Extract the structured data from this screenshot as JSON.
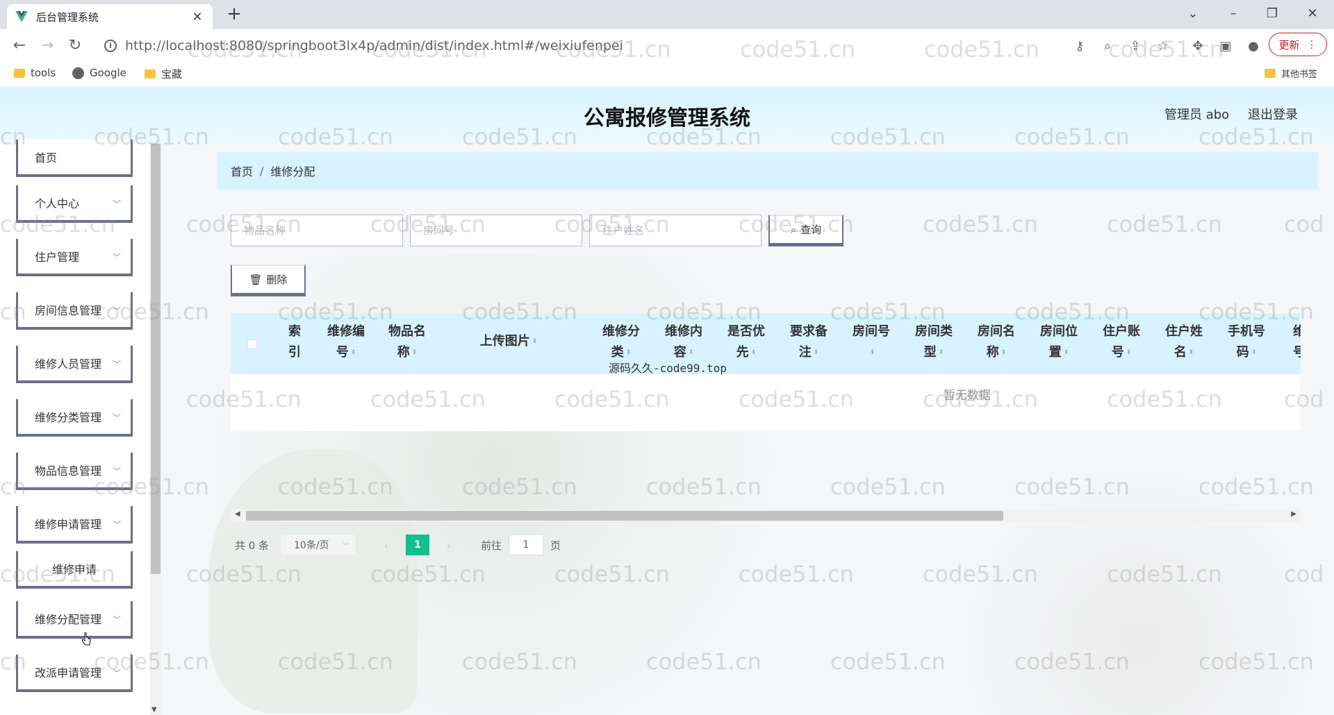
{
  "browser": {
    "tab_title": "后台管理系统",
    "url": "http://localhost:8080/springboot3lx4p/admin/dist/index.html#/weixiufenpei",
    "update_label": "更新",
    "bookmarks": [
      "tools",
      "Google",
      "宝藏"
    ],
    "other_bookmarks": "其他书签"
  },
  "header": {
    "title": "公寓报修管理系统",
    "user": "管理员 abo",
    "logout": "退出登录"
  },
  "sidebar": {
    "items": [
      {
        "label": "首页"
      },
      {
        "label": "个人中心"
      },
      {
        "label": "住户管理"
      },
      {
        "label": "房间信息管理"
      },
      {
        "label": "维修人员管理"
      },
      {
        "label": "维修分类管理"
      },
      {
        "label": "物品信息管理"
      },
      {
        "label": "维修申请管理"
      },
      {
        "label": "维修申请"
      },
      {
        "label": "维修分配管理"
      },
      {
        "label": "改派申请管理"
      }
    ]
  },
  "breadcrumb": {
    "home": "首页",
    "sep": "/",
    "current": "维修分配"
  },
  "search": {
    "item_name_placeholder": "物品名称",
    "room_no_placeholder": "房间号",
    "resident_name_placeholder": "住户姓名",
    "query_label": "查询"
  },
  "actions": {
    "delete_label": "删除"
  },
  "table": {
    "columns": [
      {
        "l1": "索",
        "l2": "引"
      },
      {
        "l1": "维修编",
        "l2": "号"
      },
      {
        "l1": "物品名",
        "l2": "称"
      },
      {
        "l1": "上传图片",
        "l2": ""
      },
      {
        "l1": "维修分",
        "l2": "类"
      },
      {
        "l1": "维修内",
        "l2": "容"
      },
      {
        "l1": "是否优",
        "l2": "先"
      },
      {
        "l1": "要求备",
        "l2": "注"
      },
      {
        "l1": "房间号",
        "l2": ""
      },
      {
        "l1": "房间类",
        "l2": "型"
      },
      {
        "l1": "房间名",
        "l2": "称"
      },
      {
        "l1": "房间位",
        "l2": "置"
      },
      {
        "l1": "住户账",
        "l2": "号"
      },
      {
        "l1": "住户姓",
        "l2": "名"
      },
      {
        "l1": "手机号",
        "l2": "码"
      },
      {
        "l1": "维",
        "l2": "号"
      }
    ],
    "overlay_text": "源码久久-code99.top",
    "empty_text": "暂无数据"
  },
  "pagination": {
    "total": "共 0 条",
    "page_size": "10条/页",
    "current_page": "1",
    "goto_label": "前往",
    "goto_value": "1",
    "page_suffix": "页"
  },
  "watermark": "code51.cn",
  "watermark_partial_left": "cn",
  "watermark_partial_right": "cod"
}
